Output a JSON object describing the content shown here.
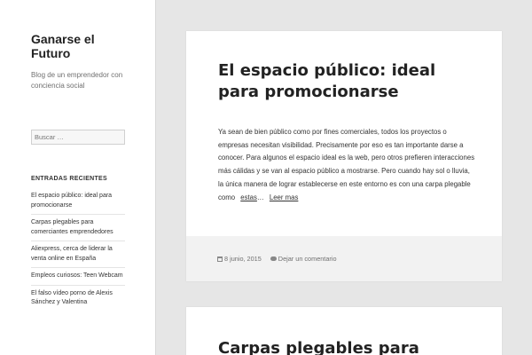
{
  "site": {
    "title": "Ganarse el Futuro",
    "description": "Blog de un emprendedor con conciencia social"
  },
  "search": {
    "placeholder": "Buscar …"
  },
  "recent": {
    "title": "ENTRADAS RECIENTES",
    "items": [
      "El espacio público: ideal para promocionarse",
      "Carpas plegables para comerciantes emprendedores",
      "Aliexpress, cerca de liderar la venta online en España",
      "Empleos curiosos: Teen Webcam",
      "El falso vídeo porno de Alexis Sánchez y Valentina"
    ]
  },
  "posts": [
    {
      "title": "El espacio público: ideal para promocionarse",
      "excerpt": "Ya sean de bien público como por fines comerciales, todos los proyectos o empresas necesitan visibilidad. Precisamente por eso es tan importante darse a conocer. Para algunos el espacio ideal es la web, pero otros prefieren interacciones más cálidas y se van al espacio público a mostrarse. Pero cuando hay sol o lluvia, la única manera de lograr establecerse en este entorno es con una carpa plegable como",
      "inline_link": "estas",
      "ellipsis": "…",
      "more_link": "Leer mas",
      "date": "8 junio, 2015",
      "comment_link": "Dejar un comentario",
      "icons": {
        "date": "calendar-icon",
        "comment": "comment-icon"
      }
    },
    {
      "title": "Carpas plegables para"
    }
  ]
}
